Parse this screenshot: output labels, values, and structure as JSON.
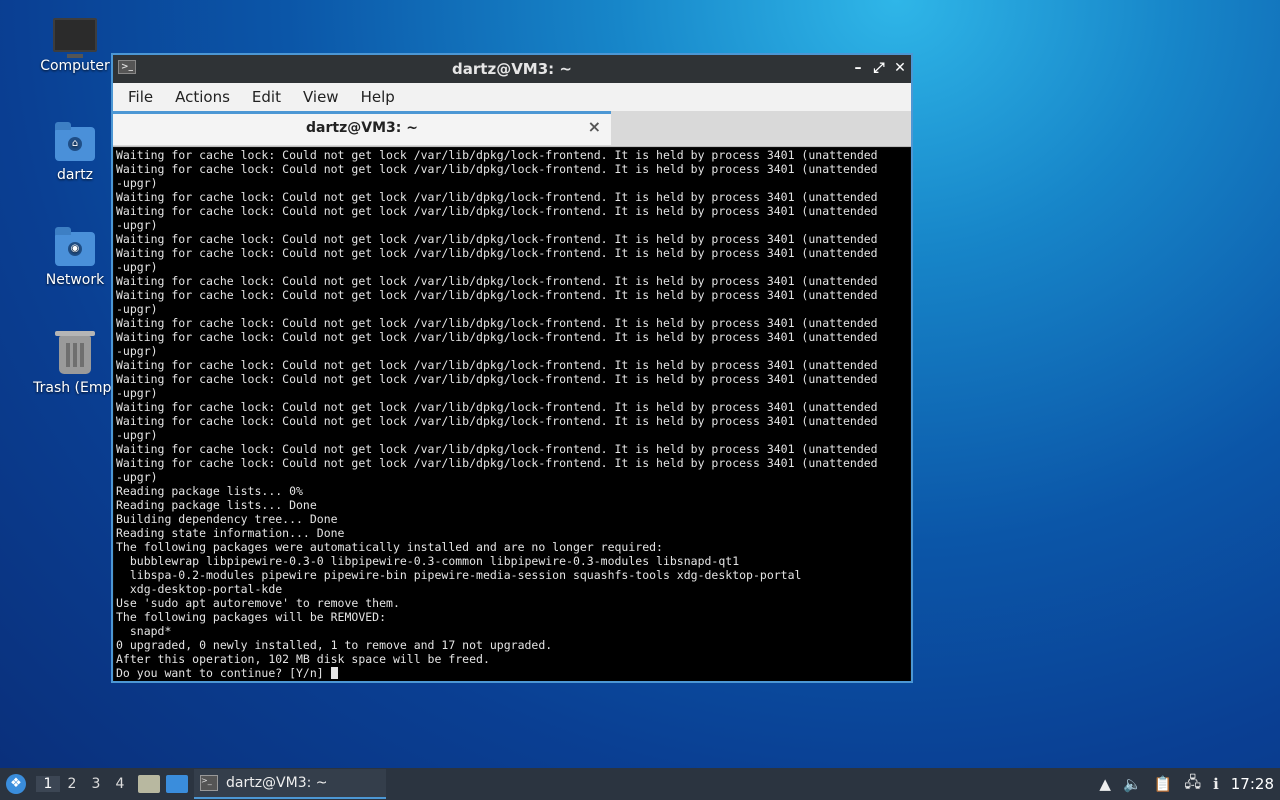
{
  "desktop": {
    "icons": [
      {
        "label": "Computer"
      },
      {
        "label": "dartz"
      },
      {
        "label": "Network"
      },
      {
        "label": "Trash (Empt"
      }
    ]
  },
  "window": {
    "title": "dartz@VM3: ~",
    "controls": {
      "minimize": "–",
      "maximize": "⤢",
      "close": "✕"
    },
    "menu": [
      "File",
      "Actions",
      "Edit",
      "View",
      "Help"
    ],
    "tab": {
      "label": "dartz@VM3: ~",
      "close": "×"
    }
  },
  "terminal": {
    "lines": [
      "Waiting for cache lock: Could not get lock /var/lib/dpkg/lock-frontend. It is held by process 3401 (unattended",
      "Waiting for cache lock: Could not get lock /var/lib/dpkg/lock-frontend. It is held by process 3401 (unattended",
      "-upgr)",
      "Waiting for cache lock: Could not get lock /var/lib/dpkg/lock-frontend. It is held by process 3401 (unattended",
      "Waiting for cache lock: Could not get lock /var/lib/dpkg/lock-frontend. It is held by process 3401 (unattended",
      "-upgr)",
      "Waiting for cache lock: Could not get lock /var/lib/dpkg/lock-frontend. It is held by process 3401 (unattended",
      "Waiting for cache lock: Could not get lock /var/lib/dpkg/lock-frontend. It is held by process 3401 (unattended",
      "-upgr)",
      "Waiting for cache lock: Could not get lock /var/lib/dpkg/lock-frontend. It is held by process 3401 (unattended",
      "Waiting for cache lock: Could not get lock /var/lib/dpkg/lock-frontend. It is held by process 3401 (unattended",
      "-upgr)",
      "Waiting for cache lock: Could not get lock /var/lib/dpkg/lock-frontend. It is held by process 3401 (unattended",
      "Waiting for cache lock: Could not get lock /var/lib/dpkg/lock-frontend. It is held by process 3401 (unattended",
      "-upgr)",
      "Waiting for cache lock: Could not get lock /var/lib/dpkg/lock-frontend. It is held by process 3401 (unattended",
      "Waiting for cache lock: Could not get lock /var/lib/dpkg/lock-frontend. It is held by process 3401 (unattended",
      "-upgr)",
      "Waiting for cache lock: Could not get lock /var/lib/dpkg/lock-frontend. It is held by process 3401 (unattended",
      "Waiting for cache lock: Could not get lock /var/lib/dpkg/lock-frontend. It is held by process 3401 (unattended",
      "-upgr)",
      "Waiting for cache lock: Could not get lock /var/lib/dpkg/lock-frontend. It is held by process 3401 (unattended",
      "Waiting for cache lock: Could not get lock /var/lib/dpkg/lock-frontend. It is held by process 3401 (unattended",
      "-upgr)",
      "Reading package lists... 0%",
      "Reading package lists... Done",
      "Building dependency tree... Done",
      "Reading state information... Done",
      "The following packages were automatically installed and are no longer required:",
      "  bubblewrap libpipewire-0.3-0 libpipewire-0.3-common libpipewire-0.3-modules libsnapd-qt1",
      "  libspa-0.2-modules pipewire pipewire-bin pipewire-media-session squashfs-tools xdg-desktop-portal",
      "  xdg-desktop-portal-kde",
      "Use 'sudo apt autoremove' to remove them.",
      "The following packages will be REMOVED:",
      "  snapd*",
      "0 upgraded, 0 newly installed, 1 to remove and 17 not upgraded.",
      "After this operation, 102 MB disk space will be freed."
    ],
    "prompt": "Do you want to continue? [Y/n] "
  },
  "taskbar": {
    "workspaces": [
      "1",
      "2",
      "3",
      "4"
    ],
    "active_workspace": "1",
    "task_label": "dartz@VM3: ~",
    "clock": "17:28"
  }
}
